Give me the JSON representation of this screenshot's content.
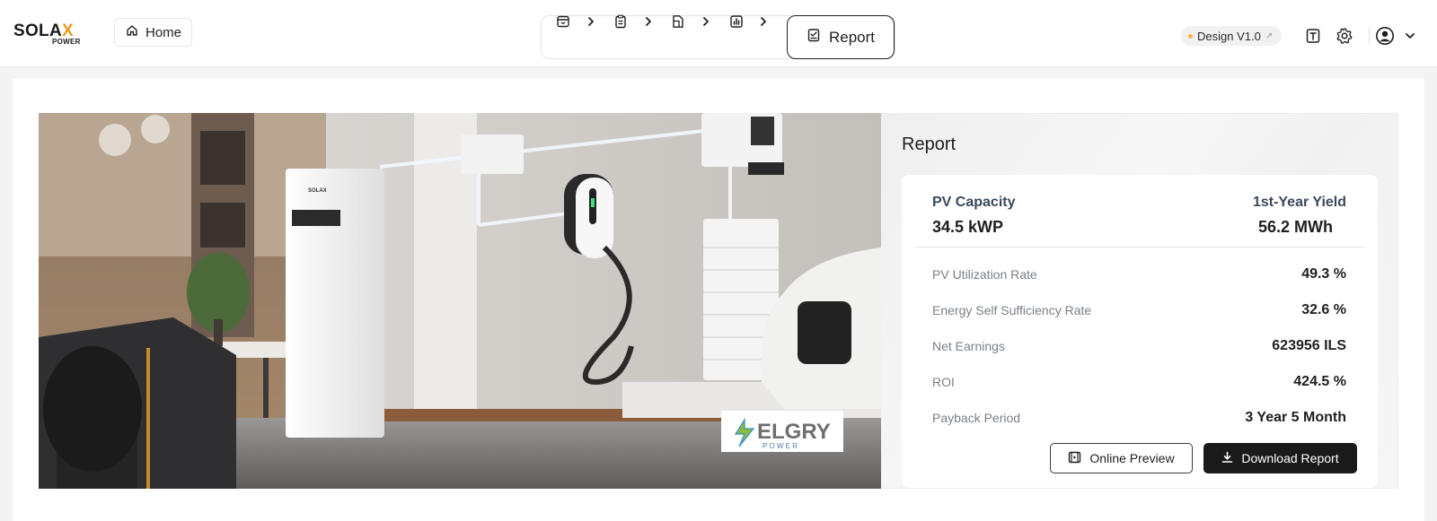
{
  "brand": {
    "name_main": "SOLA",
    "name_accent": "X",
    "name_sub": "POWER",
    "accent_color": "#f39a1c"
  },
  "header": {
    "home_label": "Home",
    "steps": [
      {
        "icon": "box-icon"
      },
      {
        "icon": "clipboard-icon"
      },
      {
        "icon": "document-icon"
      },
      {
        "icon": "bar-chart-icon"
      }
    ],
    "active_step_label": "Report",
    "version_label": "Design V1.0",
    "version_ext": "↗"
  },
  "hero": {
    "wall_logo_text": "ELGRY",
    "wall_logo_sub": "P O W E R",
    "brand_mark": "SOLAX"
  },
  "report": {
    "title": "Report",
    "pv_capacity_label": "PV Capacity",
    "pv_capacity_value": "34.5 kWP",
    "first_year_yield_label": "1st-Year Yield",
    "first_year_yield_value": "56.2 MWh",
    "rows": [
      {
        "label": "PV Utilization Rate",
        "value": "49.3 %"
      },
      {
        "label": "Energy Self Sufficiency Rate",
        "value": "32.6 %"
      },
      {
        "label": "Net Earnings",
        "value": "623956 ILS"
      },
      {
        "label": "ROI",
        "value": "424.5 %"
      },
      {
        "label": "Payback Period",
        "value": "3 Year 5 Month"
      }
    ],
    "online_preview_label": "Online Preview",
    "download_label": "Download Report"
  }
}
